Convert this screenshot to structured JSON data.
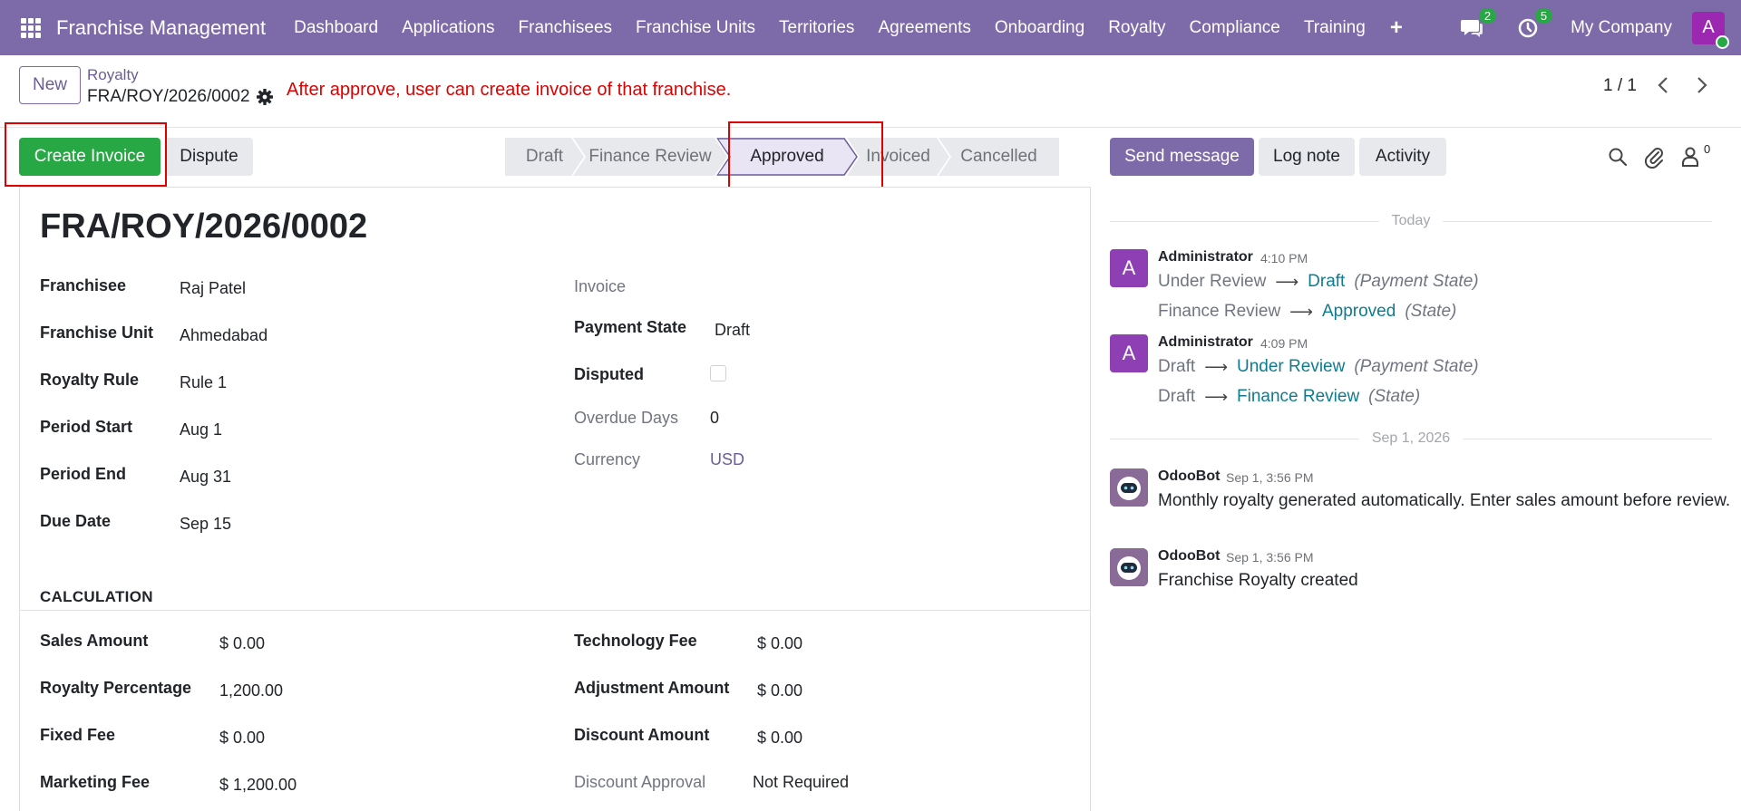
{
  "navbar": {
    "brand": "Franchise Management",
    "menu": [
      "Dashboard",
      "Applications",
      "Franchisees",
      "Franchise Units",
      "Territories",
      "Agreements",
      "Onboarding",
      "Royalty",
      "Compliance",
      "Training"
    ],
    "plus": "+",
    "messages_count": "2",
    "activities_count": "5",
    "company": "My Company",
    "user_initial": "A"
  },
  "control": {
    "new_label": "New",
    "breadcrumb_parent": "Royalty",
    "breadcrumb_current": "FRA/ROY/2026/0002",
    "annotation": "After approve, user can create invoice of that franchise.",
    "pager": "1 / 1"
  },
  "actions": {
    "create_invoice": "Create Invoice",
    "dispute": "Dispute"
  },
  "statusbar": {
    "stages": [
      "Draft",
      "Finance Review",
      "Approved",
      "Invoiced",
      "Cancelled"
    ],
    "active": "Approved"
  },
  "form": {
    "title": "FRA/ROY/2026/0002",
    "left": [
      {
        "label": "Franchisee",
        "value": "Raj Patel"
      },
      {
        "label": "Franchise Unit",
        "value": "Ahmedabad"
      },
      {
        "label": "Royalty Rule",
        "value": "Rule 1"
      },
      {
        "label": "Period Start",
        "value": "Aug 1"
      },
      {
        "label": "Period End",
        "value": "Aug 31"
      },
      {
        "label": "Due Date",
        "value": "Sep 15"
      }
    ],
    "right": {
      "invoice_label": "Invoice",
      "payment_state_label": "Payment State",
      "payment_state_value": "Draft",
      "disputed_label": "Disputed",
      "overdue_label": "Overdue Days",
      "overdue_value": "0",
      "currency_label": "Currency",
      "currency_value": "USD"
    },
    "calculation": {
      "title": "CALCULATION",
      "left": [
        {
          "label": "Sales Amount",
          "value": "$ 0.00"
        },
        {
          "label": "Royalty Percentage",
          "value": "1,200.00"
        },
        {
          "label": "Fixed Fee",
          "value": "$ 0.00"
        },
        {
          "label": "Marketing Fee",
          "value": "$ 1,200.00"
        }
      ],
      "right": [
        {
          "label": "Technology Fee",
          "value": "$ 0.00"
        },
        {
          "label": "Adjustment Amount",
          "value": "$ 0.00"
        },
        {
          "label": "Discount Amount",
          "value": "$ 0.00"
        },
        {
          "label": "Discount Approval",
          "value": "Not Required"
        }
      ]
    }
  },
  "chatter": {
    "send_message": "Send message",
    "log_note": "Log note",
    "activity": "Activity",
    "followers_count": "0",
    "sep_today": "Today",
    "sep_date": "Sep 1, 2026",
    "messages": [
      {
        "author": "Administrator",
        "time": "4:10 PM",
        "initial": "A",
        "tracking": [
          {
            "old": "Under Review",
            "new": "Draft",
            "field": "(Payment State)"
          },
          {
            "old": "Finance Review",
            "new": "Approved",
            "field": "(State)"
          }
        ]
      },
      {
        "author": "Administrator",
        "time": "4:09 PM",
        "initial": "A",
        "tracking": [
          {
            "old": "Draft",
            "new": "Under Review",
            "field": "(Payment State)"
          },
          {
            "old": "Draft",
            "new": "Finance Review",
            "field": "(State)"
          }
        ]
      },
      {
        "author": "OdooBot",
        "time": "Sep 1, 3:56 PM",
        "body": "Monthly royalty generated automatically. Enter sales amount before review."
      },
      {
        "author": "OdooBot",
        "time": "Sep 1, 3:56 PM",
        "body": "Franchise Royalty created"
      }
    ]
  },
  "colors": {
    "brand": "#7c6ba8",
    "success": "#28a745",
    "annotation": "#e00000",
    "tracking_new": "#0f7b8f"
  }
}
